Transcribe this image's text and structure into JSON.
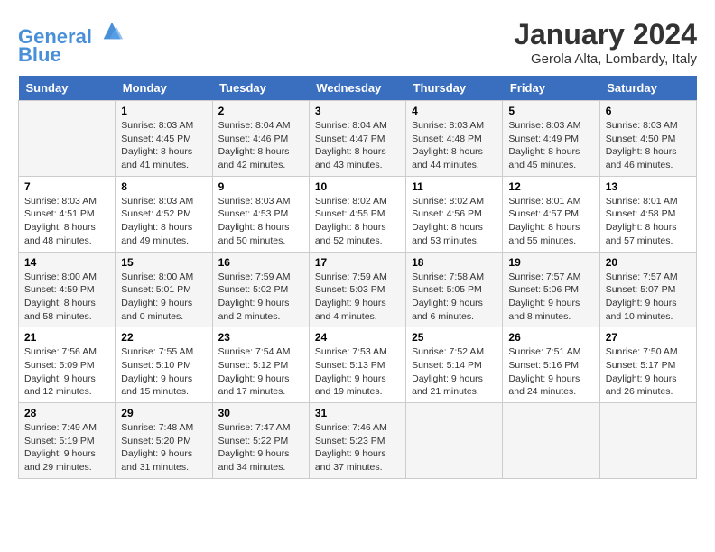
{
  "header": {
    "logo_line1": "General",
    "logo_line2": "Blue",
    "title": "January 2024",
    "location": "Gerola Alta, Lombardy, Italy"
  },
  "days_of_week": [
    "Sunday",
    "Monday",
    "Tuesday",
    "Wednesday",
    "Thursday",
    "Friday",
    "Saturday"
  ],
  "weeks": [
    [
      {
        "day": "",
        "info": ""
      },
      {
        "day": "1",
        "info": "Sunrise: 8:03 AM\nSunset: 4:45 PM\nDaylight: 8 hours\nand 41 minutes."
      },
      {
        "day": "2",
        "info": "Sunrise: 8:04 AM\nSunset: 4:46 PM\nDaylight: 8 hours\nand 42 minutes."
      },
      {
        "day": "3",
        "info": "Sunrise: 8:04 AM\nSunset: 4:47 PM\nDaylight: 8 hours\nand 43 minutes."
      },
      {
        "day": "4",
        "info": "Sunrise: 8:03 AM\nSunset: 4:48 PM\nDaylight: 8 hours\nand 44 minutes."
      },
      {
        "day": "5",
        "info": "Sunrise: 8:03 AM\nSunset: 4:49 PM\nDaylight: 8 hours\nand 45 minutes."
      },
      {
        "day": "6",
        "info": "Sunrise: 8:03 AM\nSunset: 4:50 PM\nDaylight: 8 hours\nand 46 minutes."
      }
    ],
    [
      {
        "day": "7",
        "info": "Sunrise: 8:03 AM\nSunset: 4:51 PM\nDaylight: 8 hours\nand 48 minutes."
      },
      {
        "day": "8",
        "info": "Sunrise: 8:03 AM\nSunset: 4:52 PM\nDaylight: 8 hours\nand 49 minutes."
      },
      {
        "day": "9",
        "info": "Sunrise: 8:03 AM\nSunset: 4:53 PM\nDaylight: 8 hours\nand 50 minutes."
      },
      {
        "day": "10",
        "info": "Sunrise: 8:02 AM\nSunset: 4:55 PM\nDaylight: 8 hours\nand 52 minutes."
      },
      {
        "day": "11",
        "info": "Sunrise: 8:02 AM\nSunset: 4:56 PM\nDaylight: 8 hours\nand 53 minutes."
      },
      {
        "day": "12",
        "info": "Sunrise: 8:01 AM\nSunset: 4:57 PM\nDaylight: 8 hours\nand 55 minutes."
      },
      {
        "day": "13",
        "info": "Sunrise: 8:01 AM\nSunset: 4:58 PM\nDaylight: 8 hours\nand 57 minutes."
      }
    ],
    [
      {
        "day": "14",
        "info": "Sunrise: 8:00 AM\nSunset: 4:59 PM\nDaylight: 8 hours\nand 58 minutes."
      },
      {
        "day": "15",
        "info": "Sunrise: 8:00 AM\nSunset: 5:01 PM\nDaylight: 9 hours\nand 0 minutes."
      },
      {
        "day": "16",
        "info": "Sunrise: 7:59 AM\nSunset: 5:02 PM\nDaylight: 9 hours\nand 2 minutes."
      },
      {
        "day": "17",
        "info": "Sunrise: 7:59 AM\nSunset: 5:03 PM\nDaylight: 9 hours\nand 4 minutes."
      },
      {
        "day": "18",
        "info": "Sunrise: 7:58 AM\nSunset: 5:05 PM\nDaylight: 9 hours\nand 6 minutes."
      },
      {
        "day": "19",
        "info": "Sunrise: 7:57 AM\nSunset: 5:06 PM\nDaylight: 9 hours\nand 8 minutes."
      },
      {
        "day": "20",
        "info": "Sunrise: 7:57 AM\nSunset: 5:07 PM\nDaylight: 9 hours\nand 10 minutes."
      }
    ],
    [
      {
        "day": "21",
        "info": "Sunrise: 7:56 AM\nSunset: 5:09 PM\nDaylight: 9 hours\nand 12 minutes."
      },
      {
        "day": "22",
        "info": "Sunrise: 7:55 AM\nSunset: 5:10 PM\nDaylight: 9 hours\nand 15 minutes."
      },
      {
        "day": "23",
        "info": "Sunrise: 7:54 AM\nSunset: 5:12 PM\nDaylight: 9 hours\nand 17 minutes."
      },
      {
        "day": "24",
        "info": "Sunrise: 7:53 AM\nSunset: 5:13 PM\nDaylight: 9 hours\nand 19 minutes."
      },
      {
        "day": "25",
        "info": "Sunrise: 7:52 AM\nSunset: 5:14 PM\nDaylight: 9 hours\nand 21 minutes."
      },
      {
        "day": "26",
        "info": "Sunrise: 7:51 AM\nSunset: 5:16 PM\nDaylight: 9 hours\nand 24 minutes."
      },
      {
        "day": "27",
        "info": "Sunrise: 7:50 AM\nSunset: 5:17 PM\nDaylight: 9 hours\nand 26 minutes."
      }
    ],
    [
      {
        "day": "28",
        "info": "Sunrise: 7:49 AM\nSunset: 5:19 PM\nDaylight: 9 hours\nand 29 minutes."
      },
      {
        "day": "29",
        "info": "Sunrise: 7:48 AM\nSunset: 5:20 PM\nDaylight: 9 hours\nand 31 minutes."
      },
      {
        "day": "30",
        "info": "Sunrise: 7:47 AM\nSunset: 5:22 PM\nDaylight: 9 hours\nand 34 minutes."
      },
      {
        "day": "31",
        "info": "Sunrise: 7:46 AM\nSunset: 5:23 PM\nDaylight: 9 hours\nand 37 minutes."
      },
      {
        "day": "",
        "info": ""
      },
      {
        "day": "",
        "info": ""
      },
      {
        "day": "",
        "info": ""
      }
    ]
  ]
}
